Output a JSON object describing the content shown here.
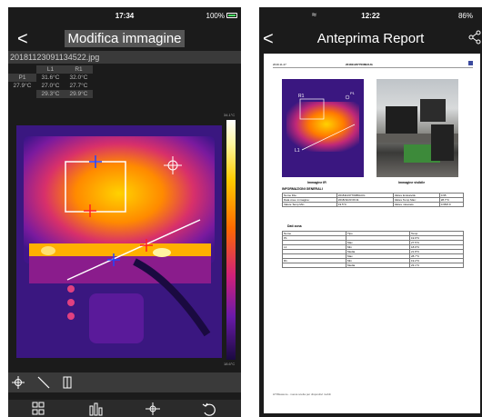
{
  "left_screen": {
    "status": {
      "time": "17:34",
      "battery": "100%"
    },
    "back_label": "<",
    "title": "Modifica immagine",
    "filename": "20181123091134522.jpg",
    "measure_table": {
      "header": [
        "",
        "L1",
        "R1"
      ],
      "rows": [
        [
          "P1",
          "31.6°C",
          "32.0°C"
        ],
        [
          "27.9°C",
          "27.0°C",
          "27.7°C"
        ],
        [
          "",
          "29.3°C",
          "29.9°C"
        ]
      ]
    },
    "scale_max": "34.1°C",
    "scale_min": "18.6°C",
    "tools": [
      "point-tool-icon",
      "line-tool-icon",
      "area-tool-icon"
    ],
    "bottom_icons": [
      "grid-icon",
      "histogram-icon",
      "crosshair-icon",
      "undo-icon"
    ]
  },
  "right_screen": {
    "status": {
      "time": "12:22",
      "battery": "86%"
    },
    "back_label": "<",
    "title": "Anteprima Report",
    "report": {
      "header_left": "2019.11.27",
      "header_center": "20181123770086AUG",
      "label_r1": "R1",
      "label_l1": "L1",
      "label_p1": "P1",
      "caption_ir": "Immagine IR",
      "caption_visible": "Immagine visibile",
      "section_general": "INFORMAZIONI GENERALI",
      "general_table": [
        [
          "Nome File:",
          "20181123770086AUG",
          "Valore Emissività:",
          "0.95"
        ],
        [
          "Data crea. immagine:",
          "2018/11/23 09:11",
          "Valore Temp Max:",
          "28.7°C"
        ],
        [
          "Valore Temp Min:",
          "19.5°C",
          "Valore misurato:",
          "0.95/0.9"
        ]
      ],
      "section_zones": "Dati zona",
      "zone_header": [
        "Nome",
        "Tipo",
        "Temp"
      ],
      "zone_rows": [
        [
          "P1",
          "",
          "19.9°C"
        ],
        [
          "",
          "Max",
          "27.5°C"
        ],
        [
          "L1",
          "Min",
          "18.9°C"
        ],
        [
          "",
          "Media",
          "21.8°C"
        ],
        [
          "",
          "Max",
          "28.7°C"
        ],
        [
          "R1",
          "Min",
          "19.2°C"
        ],
        [
          "",
          "Media",
          "23.1°C"
        ]
      ],
      "footer": "HTIMeasure - nuova scelta per dispositivi mobili"
    }
  }
}
